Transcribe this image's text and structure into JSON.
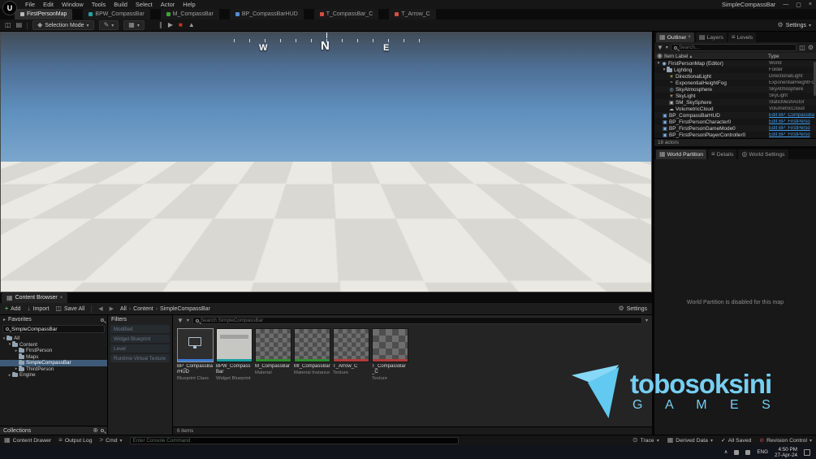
{
  "colors": {
    "watermark_blue": "#76cff2",
    "edit_link_blue": "#3f9bea",
    "selection_blue": "#3d5a78",
    "stripe_blueprint": "#3a7bd5",
    "stripe_widget": "#18a0a0",
    "stripe_material": "#2e8f2e",
    "stripe_texture": "#b03a3a",
    "stop_red": "#c0392b",
    "add_green": "#53c553"
  },
  "icons": {
    "caret_down": "▾",
    "arrow_right": "▸",
    "gear": "⚙",
    "close": "×",
    "minimize": "—",
    "maximize": "▢",
    "check": "✓",
    "chevron": "›",
    "plus": "+",
    "import_arrow": "↓",
    "save": "◫",
    "layers": "▤",
    "grid": "▦",
    "list": "≡",
    "back": "◀",
    "forward": "▶",
    "pause": "∥",
    "step": "▶",
    "stop": "■",
    "eject": "▲",
    "pencil": "✎",
    "cursor": "◆",
    "sun": "☀",
    "cloud": "☁",
    "world": "◉",
    "fog": "≈",
    "atmosphere": "◎",
    "mesh": "▣",
    "blueprint": "▣",
    "eye": "◉",
    "funnel": "▼",
    "sort_asc": "▴",
    "star": "★",
    "wrench": "⚒",
    "globe": "◎",
    "cmd_prompt": ">",
    "collections_add": "⊕",
    "tray_caret": "∧",
    "trace": "⊙",
    "revision": "⊘"
  },
  "menubar": {
    "logo": "U",
    "items": [
      "File",
      "Edit",
      "Window",
      "Tools",
      "Build",
      "Select",
      "Actor",
      "Help"
    ],
    "project_title": "SimpleCompassBar"
  },
  "tabbar": {
    "tabs": [
      {
        "label": "FirstPersonMap"
      },
      {
        "label": "BPW_CompassBar"
      },
      {
        "label": "M_CompassBar"
      },
      {
        "label": "BP_CompassBarHUD"
      },
      {
        "label": "T_CompassBar_C"
      },
      {
        "label": "T_Arrow_C"
      }
    ]
  },
  "toolbar": {
    "mode_label": "Selection Mode",
    "settings_label": "Settings"
  },
  "viewport": {
    "compass": {
      "west": "W",
      "north": "N",
      "east": "E"
    }
  },
  "outliner": {
    "tabs": [
      "Outliner",
      "Layers",
      "Levels"
    ],
    "search_placeholder": "Search...",
    "columns": {
      "label": "Item Label",
      "type": "Type"
    },
    "rows": [
      {
        "label": "FirstPersonMap (Editor)",
        "type": "World"
      },
      {
        "label": "Lighting",
        "type": "Folder"
      },
      {
        "label": "DirectionalLight",
        "type": "DirectionalLight"
      },
      {
        "label": "ExponentialHeightFog",
        "type": "ExponentialHeightFog"
      },
      {
        "label": "SkyAtmosphere",
        "type": "SkyAtmosphere"
      },
      {
        "label": "SkyLight",
        "type": "SkyLight"
      },
      {
        "label": "SM_SkySphere",
        "type": "StaticMeshActor"
      },
      {
        "label": "VolumetricCloud",
        "type": "VolumetricCloud"
      },
      {
        "label": "BP_CompassBarHUD",
        "type": "Edit BP_CompassBa"
      },
      {
        "label": "BP_FirstPersonCharacter0",
        "type": "Edit BP_FirstPerso"
      },
      {
        "label": "BP_FirstPersonGameMode0",
        "type": "Edit BP_FirstPerso"
      },
      {
        "label": "BP_FirstPersonPlayerController0",
        "type": "Edit BP_FirstPerso"
      }
    ],
    "status": "18 actors"
  },
  "details_panel": {
    "tabs": [
      "World Partition",
      "Details",
      "World Settings"
    ],
    "message": "World Partition is disabled for this map"
  },
  "content_browser": {
    "title": "Content Browser",
    "add_label": "Add",
    "import_label": "Import",
    "save_all_label": "Save All",
    "breadcrumb": [
      "All",
      "Content",
      "SimpleCompassBar"
    ],
    "settings_label": "Settings",
    "favorites_label": "Favorites",
    "sources_label": "SimpleCompassBar",
    "tree": [
      {
        "label": "All"
      },
      {
        "label": "Content"
      },
      {
        "label": "FirstPerson"
      },
      {
        "label": "Maps"
      },
      {
        "label": "SimpleCompassBar"
      },
      {
        "label": "ThirdPerson"
      },
      {
        "label": "Engine"
      }
    ],
    "collections_label": "Collections",
    "filters": {
      "title": "Filters",
      "items": [
        "Modified",
        "Widget Blueprint",
        "Level",
        "Runtime Virtual Texture"
      ]
    },
    "search_placeholder": "Search SimpleCompassBar",
    "assets": [
      {
        "name": "BP_CompassBarHUD",
        "type": "Blueprint Class"
      },
      {
        "name": "BPW_CompassBar",
        "type": "Widget Blueprint"
      },
      {
        "name": "M_CompassBar",
        "type": "Material"
      },
      {
        "name": "MI_CompassBar",
        "type": "Material Instance"
      },
      {
        "name": "T_Arrow_C",
        "type": "Texture"
      },
      {
        "name": "T_CompassBar_C",
        "type": "Texture"
      }
    ],
    "items_count": "6 items"
  },
  "status_bar": {
    "content_drawer": "Content Drawer",
    "output_log": "Output Log",
    "cmd": "Cmd",
    "console_placeholder": "Enter Console Command",
    "trace": "Trace",
    "derived_data": "Derived Data",
    "all_saved": "All Saved",
    "revision_control": "Revision Control"
  },
  "taskbar": {
    "lang": "ENG",
    "time": "4:50 PM",
    "date": "27-Apr-24"
  },
  "watermark": {
    "name": "tobosoksini",
    "sub": "G A M E S"
  }
}
